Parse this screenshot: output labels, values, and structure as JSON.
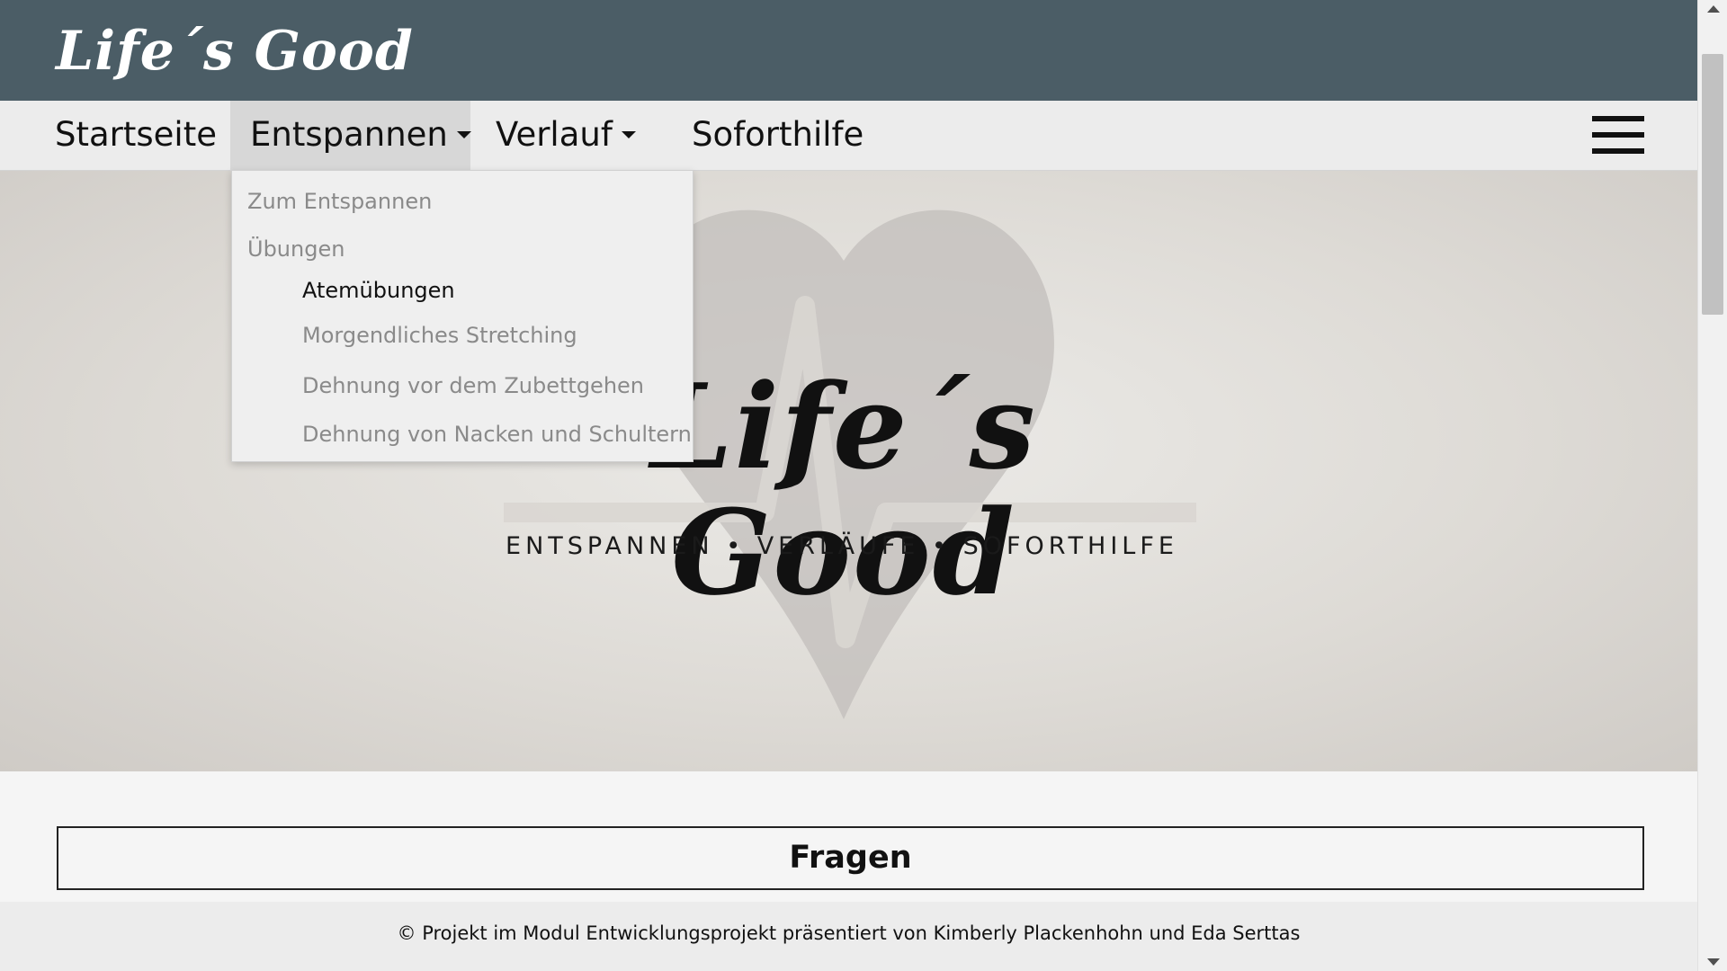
{
  "header": {
    "logo_text": "Life´s Good",
    "background_color": "#4b5d66"
  },
  "nav": {
    "items": [
      {
        "label": "Startseite",
        "has_caret": false
      },
      {
        "label": "Entspannen",
        "has_caret": true,
        "active": true
      },
      {
        "label": "Verlauf",
        "has_caret": true
      },
      {
        "label": "Soforthilfe",
        "has_caret": false
      }
    ],
    "menu_icon": "hamburger-menu-icon"
  },
  "dropdown": {
    "items": [
      {
        "label": "Zum Entspannen",
        "level": 0
      },
      {
        "label": "Übungen",
        "level": 0
      },
      {
        "label": "Atemübungen",
        "level": 1,
        "highlighted": true
      },
      {
        "label": "Morgendliches Stretching",
        "level": 1
      },
      {
        "label": "Dehnung vor dem Zubettgehen",
        "level": 1
      },
      {
        "label": "Dehnung von Nacken und Schultern",
        "level": 1
      }
    ]
  },
  "hero": {
    "script_text": "Life´s Good",
    "tagline": "ENTSPANNEN • VERLÄUFE • SOFORTHILFE",
    "emblem": "heart-pulse-icon"
  },
  "content": {
    "section_heading": "Fragen"
  },
  "footer": {
    "text": "© Projekt im Modul Entwicklungsprojekt präsentiert von Kimberly Plackenhohn und Eda Serttas"
  }
}
